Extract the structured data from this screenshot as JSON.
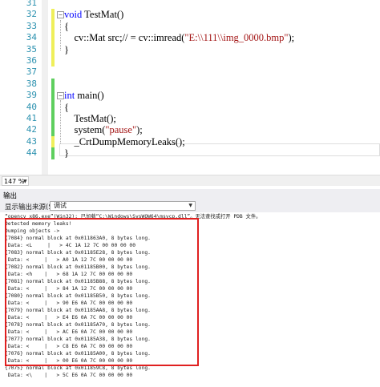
{
  "editor": {
    "lines": [
      {
        "num": "31",
        "code": ""
      },
      {
        "num": "32",
        "code": "void TestMat()"
      },
      {
        "num": "33",
        "code": "{"
      },
      {
        "num": "34",
        "code": "    cv::Mat src;// = cv::imread(\"E:\\\\111\\\\img_0000.bmp\");"
      },
      {
        "num": "35",
        "code": "}"
      },
      {
        "num": "36",
        "code": ""
      },
      {
        "num": "37",
        "code": ""
      },
      {
        "num": "38",
        "code": ""
      },
      {
        "num": "39",
        "code": "int main()"
      },
      {
        "num": "40",
        "code": "{"
      },
      {
        "num": "41",
        "code": "    TestMat();"
      },
      {
        "num": "42",
        "code": "    system(\"pause\");"
      },
      {
        "num": "43",
        "code": "    _CrtDumpMemoryLeaks();"
      },
      {
        "num": "44",
        "code": "}"
      }
    ],
    "zoom": "147 %"
  },
  "output": {
    "title": "输出",
    "source_label": "显示输出来源(S):",
    "source_value": "调试",
    "lines": [
      "“opencv_x86.exe”(Win32): 已加载“C:\\Windows\\SysWOW64\\msvcp.dll”。无法查找或打开 PDB 文件。",
      "Detected memory leaks!",
      "Dumping objects ->",
      "{7084} normal block at 0x011863A0, 8 bytes long.",
      " Data: <L     |   > 4C 1A 12 7C 00 00 00 00",
      "{7083} normal block at 0x01185E28, 8 bytes long.",
      " Data: <     |   > A0 1A 12 7C 00 00 00 00",
      "{7082} normal block at 0x01185B00, 8 bytes long.",
      " Data: <h    |   > 68 1A 12 7C 00 00 00 00",
      "{7081} normal block at 0x01185B88, 8 bytes long.",
      " Data: <     |   > 84 1A 12 7C 00 00 00 00",
      "{7080} normal block at 0x01185B50, 8 bytes long.",
      " Data: <     |   > 90 E6 0A 7C 00 00 00 00",
      "{7079} normal block at 0x01185AA8, 8 bytes long.",
      " Data: <     |   > E4 E6 0A 7C 00 00 00 00",
      "{7078} normal block at 0x01185A70, 8 bytes long.",
      " Data: <     |   > AC E6 0A 7C 00 00 00 00",
      "{7077} normal block at 0x01185A38, 8 bytes long.",
      " Data: <     |   > C8 E6 0A 7C 00 00 00 00",
      "{7076} normal block at 0x01185A00, 8 bytes long.",
      " Data: <     |   > 00 E6 0A 7C 00 00 00 00",
      "{7075} normal block at 0x011859C8, 8 bytes long.",
      " Data: <\\    |   > 5C E6 0A 7C 00 00 00 00"
    ]
  }
}
